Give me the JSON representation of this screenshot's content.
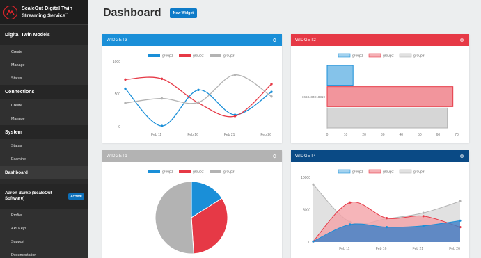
{
  "brand": {
    "line1": "ScaleOut Digital Twin",
    "line2": "Streaming Service",
    "tm": "™"
  },
  "sidebar": {
    "sections": [
      {
        "title": "Digital Twin Models",
        "items": [
          "Create",
          "Manage",
          "Status"
        ]
      },
      {
        "title": "Connections",
        "items": [
          "Create",
          "Manage"
        ]
      },
      {
        "title": "System",
        "items": [
          "Status",
          "Examine"
        ]
      }
    ],
    "dashboard_label": "Dashboard",
    "user": {
      "name": "Aaron Burke (ScaleOut Software)",
      "badge": "ACTIVE"
    },
    "user_items": [
      "Profile",
      "API Keys",
      "Support",
      "Documentation"
    ]
  },
  "header": {
    "title": "Dashboard",
    "new_widget_label": "New Widget"
  },
  "colors": {
    "group1": "#1a8fd8",
    "group2": "#e63946",
    "group3": "#b3b3b3",
    "widget3": "#1a8fd8",
    "widget2": "#e63946",
    "widget1": "#b3b3b3",
    "widget4": "#0a4a85"
  },
  "widgets": {
    "w3": {
      "title": "WIDGET3",
      "gear": "⚙"
    },
    "w2": {
      "title": "WIDGET2",
      "gear": "⚙"
    },
    "w1": {
      "title": "WIDGET1",
      "gear": "⚙"
    },
    "w4": {
      "title": "WIDGET4",
      "gear": "⚙"
    }
  },
  "chart_data": [
    {
      "id": "widget3",
      "type": "line",
      "legend": [
        "group1",
        "group2",
        "group3"
      ],
      "legend_position": "top-center",
      "x": [
        0,
        1,
        2,
        3,
        4,
        5
      ],
      "xticks": [
        "Feb 11",
        "Feb 16",
        "Feb 21",
        "Feb 26"
      ],
      "yticks": [
        "0",
        "500",
        "1000"
      ],
      "ylim": [
        0,
        1000
      ],
      "series": [
        {
          "name": "group1",
          "values": [
            580,
            10,
            560,
            180,
            530
          ]
        },
        {
          "name": "group2",
          "values": [
            720,
            730,
            360,
            160,
            650
          ]
        },
        {
          "name": "group3",
          "values": [
            360,
            430,
            370,
            790,
            460
          ]
        }
      ]
    },
    {
      "id": "widget2",
      "type": "bar",
      "orientation": "horizontal",
      "legend": [
        "group1",
        "group2",
        "group3"
      ],
      "legend_position": "top-center",
      "categories": [
        "1663484918319"
      ],
      "xticks": [
        "0",
        "10",
        "20",
        "30",
        "40",
        "50",
        "60",
        "70"
      ],
      "xlim": [
        0,
        70
      ],
      "series": [
        {
          "name": "group1",
          "values": [
            14
          ]
        },
        {
          "name": "group2",
          "values": [
            68
          ]
        },
        {
          "name": "group3",
          "values": [
            65
          ]
        }
      ]
    },
    {
      "id": "widget1",
      "type": "pie",
      "legend": [
        "group1",
        "group2",
        "group3"
      ],
      "legend_position": "top-center",
      "series": [
        {
          "name": "group1",
          "values": [
            16
          ]
        },
        {
          "name": "group2",
          "values": [
            33
          ]
        },
        {
          "name": "group3",
          "values": [
            51
          ]
        }
      ]
    },
    {
      "id": "widget4",
      "type": "area",
      "legend": [
        "group1",
        "group2",
        "group3"
      ],
      "legend_position": "top-center",
      "xticks": [
        "Feb 11",
        "Feb 16",
        "Feb 21",
        "Feb 26"
      ],
      "yticks": [
        "0",
        "5000",
        "10000"
      ],
      "ylim": [
        0,
        10000
      ],
      "series": [
        {
          "name": "group1",
          "values": [
            100,
            2700,
            2300,
            2500,
            3300
          ]
        },
        {
          "name": "group2",
          "values": [
            100,
            6100,
            3700,
            4000,
            2300
          ]
        },
        {
          "name": "group3",
          "values": [
            8900,
            3100,
            3600,
            4500,
            6300
          ]
        }
      ]
    }
  ]
}
